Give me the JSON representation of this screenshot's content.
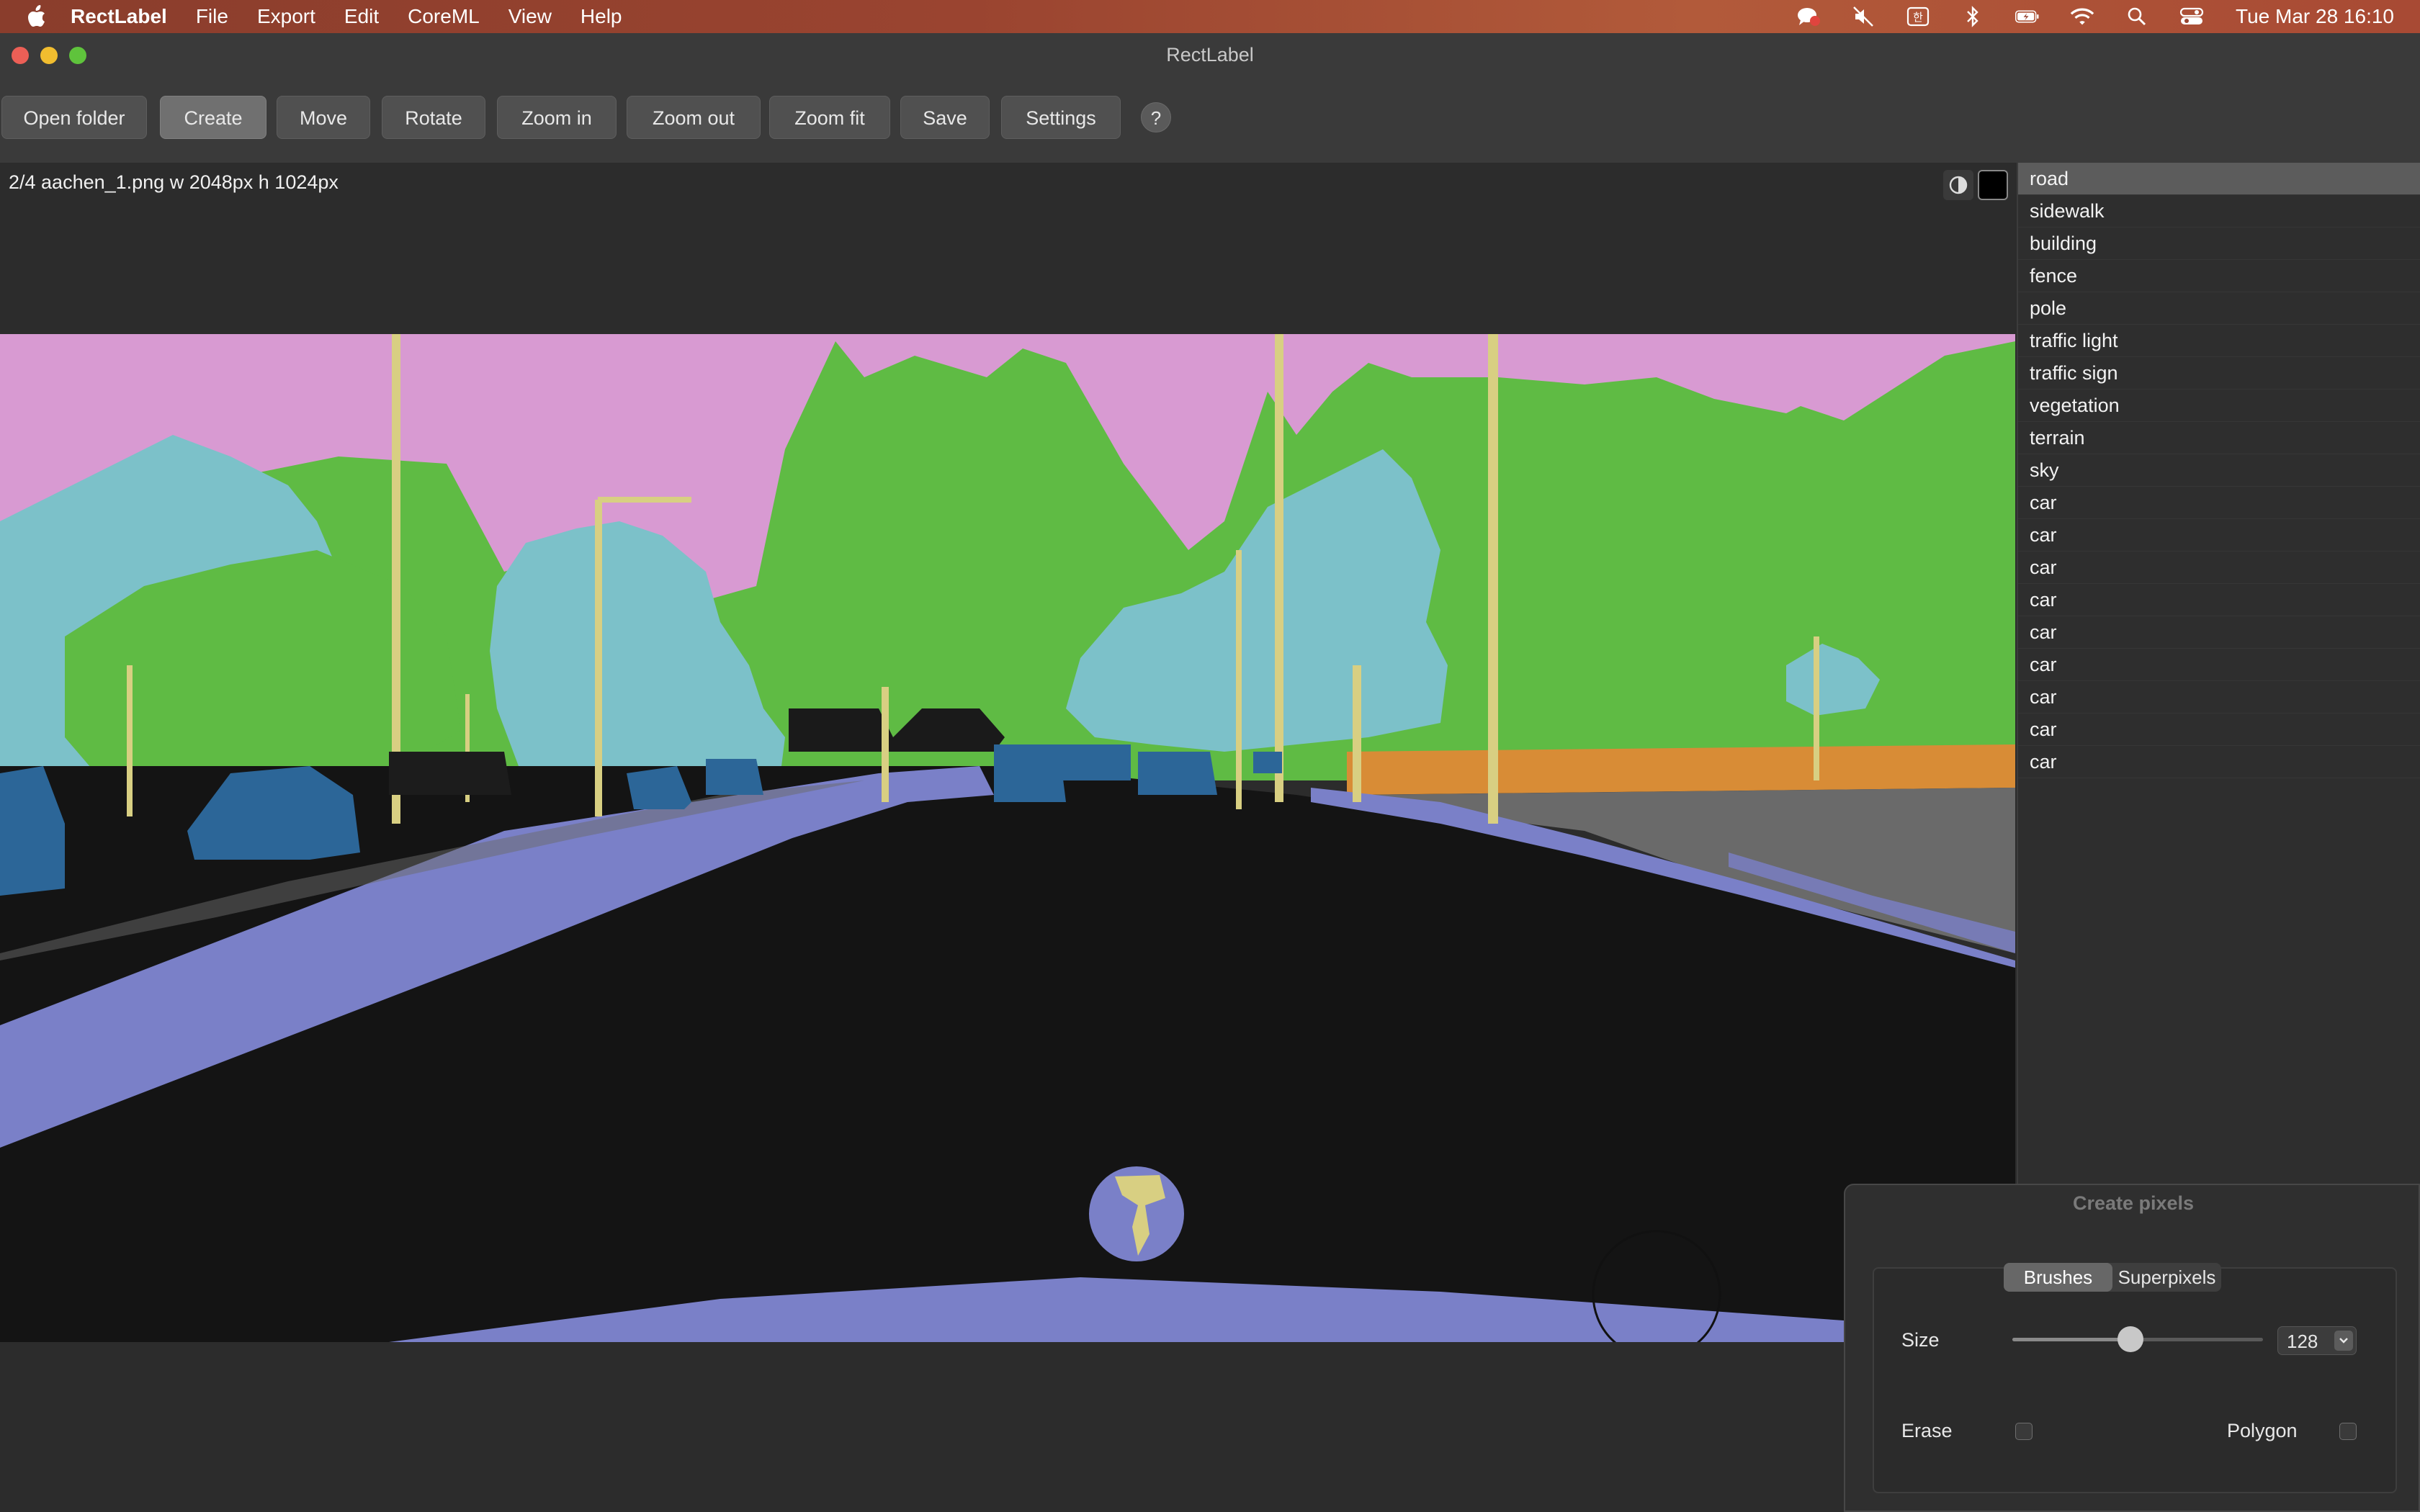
{
  "menubar": {
    "app_name": "RectLabel",
    "items": [
      "File",
      "Export",
      "Edit",
      "CoreML",
      "View",
      "Help"
    ],
    "clock": "Tue Mar 28  16:10",
    "status_icons": [
      "messages-icon",
      "mute-icon",
      "input-source-icon",
      "bluetooth-icon",
      "battery-icon",
      "wifi-icon",
      "spotlight-icon",
      "control-center-icon"
    ]
  },
  "window": {
    "title": "RectLabel"
  },
  "toolbar": {
    "open_folder": "Open folder",
    "create": "Create",
    "move": "Move",
    "rotate": "Rotate",
    "zoom_in": "Zoom in",
    "zoom_out": "Zoom out",
    "zoom_fit": "Zoom fit",
    "save": "Save",
    "settings": "Settings",
    "help": "?"
  },
  "canvas": {
    "file_info": "2/4 aachen_1.png w 2048px h 1024px"
  },
  "labels": [
    {
      "name": "road",
      "selected": true
    },
    {
      "name": "sidewalk"
    },
    {
      "name": "building"
    },
    {
      "name": "fence"
    },
    {
      "name": "pole"
    },
    {
      "name": "traffic light"
    },
    {
      "name": "traffic sign"
    },
    {
      "name": "vegetation"
    },
    {
      "name": "terrain"
    },
    {
      "name": "sky"
    },
    {
      "name": "car"
    },
    {
      "name": "car"
    },
    {
      "name": "car"
    },
    {
      "name": "car"
    },
    {
      "name": "car"
    },
    {
      "name": "car"
    },
    {
      "name": "car"
    },
    {
      "name": "car"
    },
    {
      "name": "car"
    }
  ],
  "panel": {
    "title": "Create pixels",
    "tabs": [
      "Brushes",
      "Superpixels"
    ],
    "active_tab": "Brushes",
    "size_label": "Size",
    "size_value": "128",
    "size_slider_fraction": 0.47,
    "erase_label": "Erase",
    "erase_checked": false,
    "polygon_label": "Polygon",
    "polygon_checked": false
  },
  "colors": {
    "sky": "#d89ad2",
    "building": "#5fbb44",
    "vegetation": "#7cc1c9",
    "road": "#141414",
    "sidewalk": "#7a80c8",
    "pole": "#d8cf82",
    "car": "#2c6698",
    "fence": "#d88c36"
  }
}
